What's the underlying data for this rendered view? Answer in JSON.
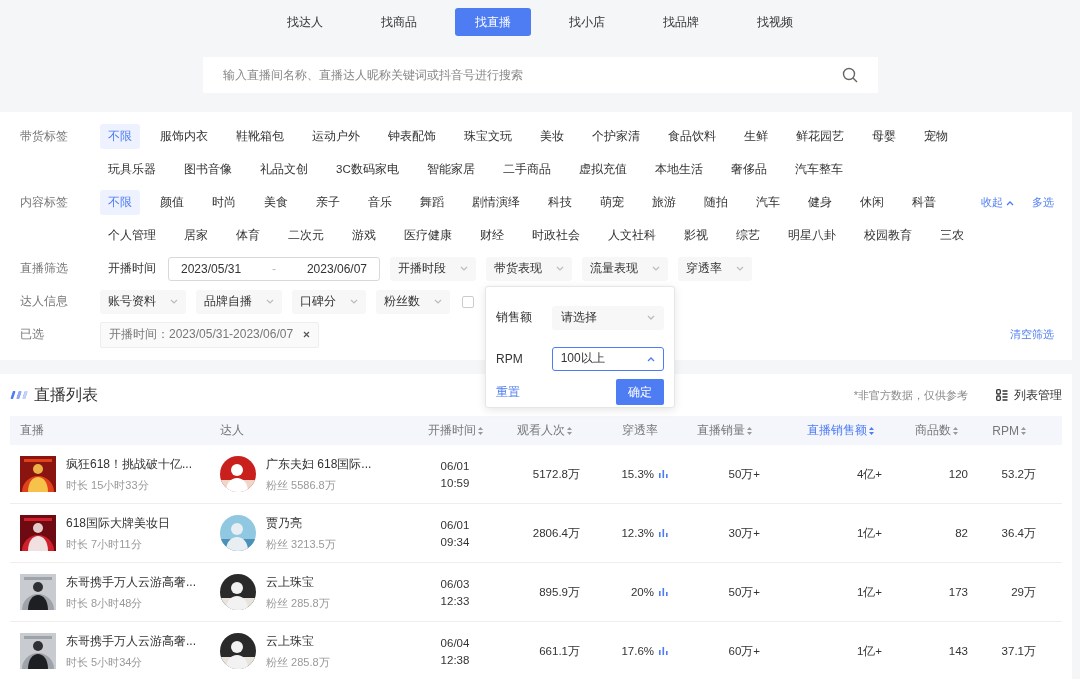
{
  "nav_tabs": [
    {
      "label": "找达人",
      "selected": false
    },
    {
      "label": "找商品",
      "selected": false
    },
    {
      "label": "找直播",
      "selected": true
    },
    {
      "label": "找小店",
      "selected": false
    },
    {
      "label": "找品牌",
      "selected": false
    },
    {
      "label": "找视频",
      "selected": false
    }
  ],
  "search": {
    "placeholder": "输入直播间名称、直播达人昵称关键词或抖音号进行搜索"
  },
  "filters": {
    "tag_rows": [
      {
        "label": "带货标签",
        "lines": [
          [
            {
              "label": "不限",
              "selected": true
            },
            {
              "label": "服饰内衣",
              "selected": false
            },
            {
              "label": "鞋靴箱包",
              "selected": false
            },
            {
              "label": "运动户外",
              "selected": false
            },
            {
              "label": "钟表配饰",
              "selected": false
            },
            {
              "label": "珠宝文玩",
              "selected": false
            },
            {
              "label": "美妆",
              "selected": false
            },
            {
              "label": "个护家清",
              "selected": false
            },
            {
              "label": "食品饮料",
              "selected": false
            },
            {
              "label": "生鲜",
              "selected": false
            },
            {
              "label": "鲜花园艺",
              "selected": false
            },
            {
              "label": "母婴",
              "selected": false
            },
            {
              "label": "宠物",
              "selected": false
            }
          ],
          [
            {
              "label": "玩具乐器",
              "selected": false
            },
            {
              "label": "图书音像",
              "selected": false
            },
            {
              "label": "礼品文创",
              "selected": false
            },
            {
              "label": "3C数码家电",
              "selected": false
            },
            {
              "label": "智能家居",
              "selected": false
            },
            {
              "label": "二手商品",
              "selected": false
            },
            {
              "label": "虚拟充值",
              "selected": false
            },
            {
              "label": "本地生活",
              "selected": false
            },
            {
              "label": "奢侈品",
              "selected": false
            },
            {
              "label": "汽车整车",
              "selected": false
            }
          ]
        ]
      },
      {
        "label": "内容标签",
        "lines": [
          [
            {
              "label": "不限",
              "selected": true
            },
            {
              "label": "颜值",
              "selected": false
            },
            {
              "label": "时尚",
              "selected": false
            },
            {
              "label": "美食",
              "selected": false
            },
            {
              "label": "亲子",
              "selected": false
            },
            {
              "label": "音乐",
              "selected": false
            },
            {
              "label": "舞蹈",
              "selected": false
            },
            {
              "label": "剧情演绎",
              "selected": false
            },
            {
              "label": "科技",
              "selected": false
            },
            {
              "label": "萌宠",
              "selected": false
            },
            {
              "label": "旅游",
              "selected": false
            },
            {
              "label": "随拍",
              "selected": false
            },
            {
              "label": "汽车",
              "selected": false
            },
            {
              "label": "健身",
              "selected": false
            },
            {
              "label": "休闲",
              "selected": false
            },
            {
              "label": "科普",
              "selected": false
            }
          ],
          [
            {
              "label": "个人管理",
              "selected": false
            },
            {
              "label": "居家",
              "selected": false
            },
            {
              "label": "体育",
              "selected": false
            },
            {
              "label": "二次元",
              "selected": false
            },
            {
              "label": "游戏",
              "selected": false
            },
            {
              "label": "医疗健康",
              "selected": false
            },
            {
              "label": "财经",
              "selected": false
            },
            {
              "label": "时政社会",
              "selected": false
            },
            {
              "label": "人文社科",
              "selected": false
            },
            {
              "label": "影视",
              "selected": false
            },
            {
              "label": "综艺",
              "selected": false
            },
            {
              "label": "明星八卦",
              "selected": false
            },
            {
              "label": "校园教育",
              "selected": false
            },
            {
              "label": "三农",
              "selected": false
            }
          ]
        ],
        "collapse_link": "收起",
        "multi_link": "多选"
      }
    ],
    "live_filter": {
      "label": "直播筛选",
      "date_label": "开播时间",
      "date_start": "2023/05/31",
      "date_separator": "-",
      "date_end": "2023/06/07",
      "dropdowns": [
        "开播时段",
        "带货表现",
        "流量表现",
        "穿透率"
      ]
    },
    "influencer_filter": {
      "label": "达人信息",
      "dropdowns": [
        "账号资料",
        "品牌自播",
        "口碑分",
        "粉丝数"
      ],
      "checkbox_checked": false
    },
    "selected_filter": {
      "label": "已选",
      "chip": "开播时间：2023/05/31-2023/06/07",
      "clear_link": "清空筛选"
    }
  },
  "popup": {
    "fields": [
      {
        "label": "销售额",
        "placeholder": "请选择",
        "expanded": false
      },
      {
        "label": "RPM",
        "value": "100以上",
        "expanded": true
      }
    ],
    "reset": "重置",
    "confirm": "确定"
  },
  "list": {
    "title": "直播列表",
    "note": "*非官方数据，仅供参考",
    "manage": "列表管理",
    "columns": [
      {
        "label": "直播",
        "sortable": false,
        "sorted": false
      },
      {
        "label": "达人",
        "sortable": false,
        "sorted": false
      },
      {
        "label": "开播时间",
        "sortable": true,
        "sorted": false
      },
      {
        "label": "观看人次",
        "sortable": true,
        "sorted": false
      },
      {
        "label": "穿透率",
        "sortable": false,
        "sorted": false
      },
      {
        "label": "直播销量",
        "sortable": true,
        "sorted": false
      },
      {
        "label": "直播销售额",
        "sortable": true,
        "sorted": true
      },
      {
        "label": "商品数",
        "sortable": true,
        "sorted": false
      },
      {
        "label": "RPM",
        "sortable": true,
        "sorted": false
      }
    ],
    "rows": [
      {
        "title": "疯狂618！挑战破十亿...",
        "duration": "时长 15小时33分",
        "influencer": "广东夫妇 618国际...",
        "fans": "粉丝 5586.8万",
        "date": "06/01",
        "time": "10:59",
        "views": "5172.8万",
        "penetration": "15.3%",
        "sales": "50万+",
        "amount": "4亿+",
        "goods": "120",
        "rpm": "53.2万"
      },
      {
        "title": "618国际大牌美妆日",
        "duration": "时长 7小时11分",
        "influencer": "贾乃亮",
        "fans": "粉丝 3213.5万",
        "date": "06/01",
        "time": "09:34",
        "views": "2806.4万",
        "penetration": "12.3%",
        "sales": "30万+",
        "amount": "1亿+",
        "goods": "82",
        "rpm": "36.4万"
      },
      {
        "title": "东哥携手万人云游高奢...",
        "duration": "时长 8小时48分",
        "influencer": "云上珠宝",
        "fans": "粉丝 285.8万",
        "date": "06/03",
        "time": "12:33",
        "views": "895.9万",
        "penetration": "20%",
        "sales": "50万+",
        "amount": "1亿+",
        "goods": "173",
        "rpm": "29万"
      },
      {
        "title": "东哥携手万人云游高奢...",
        "duration": "时长 5小时34分",
        "influencer": "云上珠宝",
        "fans": "粉丝 285.8万",
        "date": "06/04",
        "time": "12:38",
        "views": "661.1万",
        "penetration": "17.6%",
        "sales": "60万+",
        "amount": "1亿+",
        "goods": "143",
        "rpm": "37.1万"
      }
    ]
  }
}
